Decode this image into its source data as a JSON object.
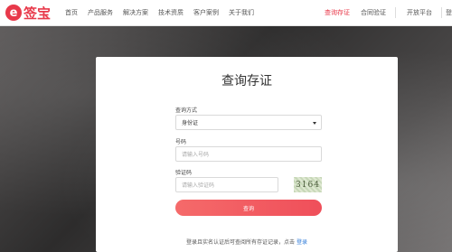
{
  "header": {
    "logo_mark": "e",
    "logo_text": "签宝",
    "nav": [
      "首页",
      "产品服务",
      "解决方案",
      "技术资质",
      "客户案例",
      "关于我们"
    ],
    "nav_right": [
      "查询存证",
      "合同验证",
      "开放平台",
      "登"
    ],
    "active": "查询存证"
  },
  "card": {
    "title": "查询存证",
    "query_type_label": "查询方式",
    "query_type_value": "身份证",
    "number_label": "号码",
    "number_placeholder": "请输入号码",
    "captcha_label": "验证码",
    "captcha_placeholder": "请输入验证码",
    "captcha_text": "3164",
    "submit_label": "查询",
    "footnote": "登录且实名认证后可查阅所有存证记录，点击",
    "footnote_link": "登录"
  },
  "colors": {
    "brand": "#e8394a",
    "link": "#2f7bd8"
  }
}
